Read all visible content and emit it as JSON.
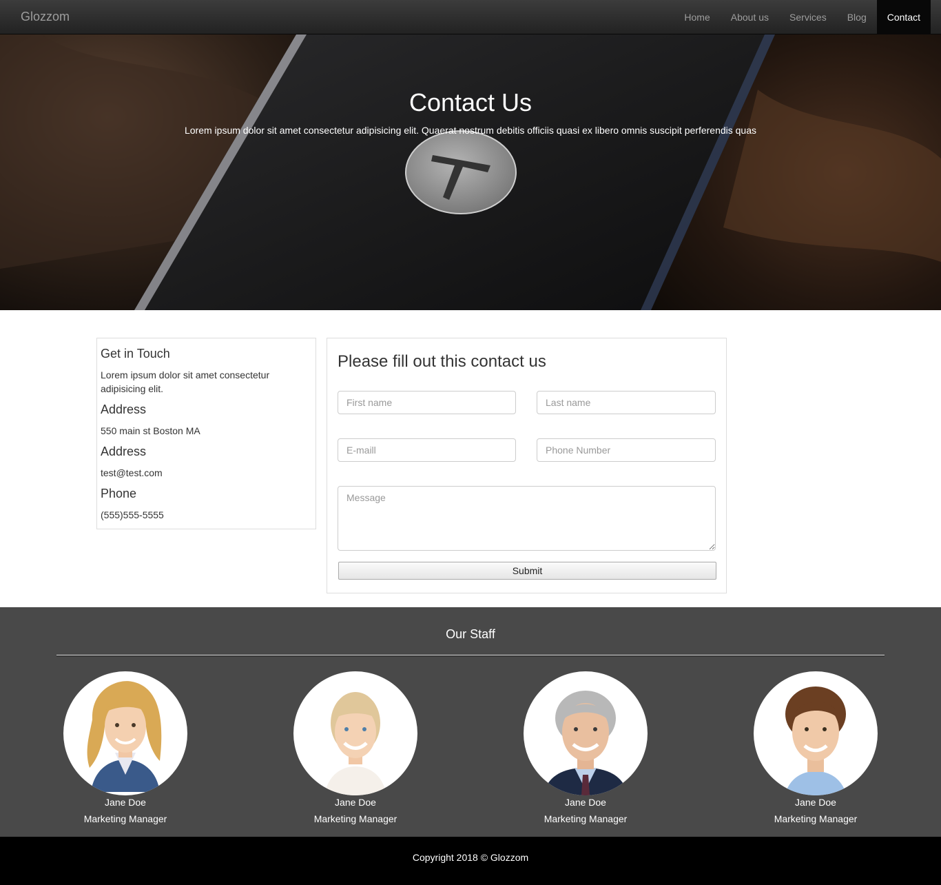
{
  "nav": {
    "brand": "Glozzom",
    "items": [
      {
        "label": "Home"
      },
      {
        "label": "About us"
      },
      {
        "label": "Services"
      },
      {
        "label": "Blog"
      },
      {
        "label": "Contact"
      }
    ]
  },
  "hero": {
    "title": "Contact Us",
    "subtitle": "Lorem ipsum dolor sit amet consectetur adipisicing elit. Quaerat nostrum debitis officiis quasi ex libero omnis suscipit perferendis quas"
  },
  "info": {
    "heading": "Get in Touch",
    "intro": "Lorem ipsum dolor sit amet consectetur adipisicing elit.",
    "address_heading": "Address",
    "address": "550 main st Boston MA",
    "email_heading": "Address",
    "email": "test@test.com",
    "phone_heading": "Phone",
    "phone": "(555)555-5555"
  },
  "form": {
    "title": "Please fill out this contact us",
    "first_name_placeholder": "First name",
    "last_name_placeholder": "Last name",
    "email_placeholder": "E-maill",
    "phone_placeholder": "Phone Number",
    "message_placeholder": "Message",
    "submit_label": "Submit"
  },
  "staff": {
    "title": "Our Staff",
    "members": [
      {
        "name": "Jane Doe",
        "role": "Marketing Manager",
        "hair": "#d9a955"
      },
      {
        "name": "Jane Doe",
        "role": "Marketing Manager",
        "hair": "#e0c79a"
      },
      {
        "name": "Jane Doe",
        "role": "Marketing Manager",
        "hair": "#b8b8b8"
      },
      {
        "name": "Jane Doe",
        "role": "Marketing Manager",
        "hair": "#6b3f22"
      }
    ]
  },
  "footer": {
    "copyright": "Copyright 2018 © Glozzom"
  }
}
